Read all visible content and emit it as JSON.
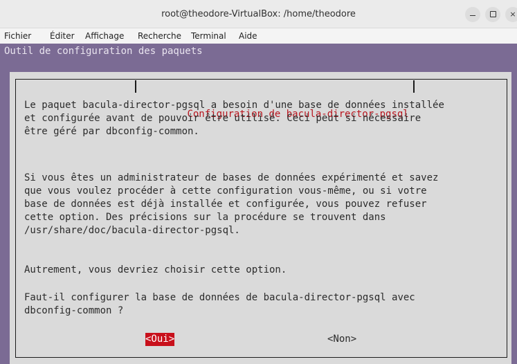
{
  "window": {
    "title": "root@theodore-VirtualBox: /home/theodore",
    "controls": {
      "minimize_icon": "minimize-icon",
      "maximize_icon": "maximize-icon",
      "close_icon": "close-icon",
      "close_glyph": "×"
    }
  },
  "menubar": {
    "items": [
      "Fichier",
      "Éditer",
      "Affichage",
      "Recherche",
      "Terminal",
      "Aide"
    ]
  },
  "terminal": {
    "backtitle": "Outil de configuration des paquets",
    "dialog": {
      "title": "Configuration de bacula-director-pgsql",
      "paragraphs": [
        "Le paquet bacula-director-pgsql a besoin d'une base de données installée\net configurée avant de pouvoir être utilisé. Ceci peut si nécessaire\nêtre géré par dbconfig-common.",
        "Si vous êtes un administrateur de bases de données expérimenté et savez\nque vous voulez procéder à cette configuration vous-même, ou si votre\nbase de données est déjà installée et configurée, vous pouvez refuser\ncette option. Des précisions sur la procédure se trouvent dans\n/usr/share/doc/bacula-director-pgsql.",
        "Autrement, vous devriez choisir cette option.",
        "Faut-il configurer la base de données de bacula-director-pgsql avec\ndbconfig-common ?"
      ],
      "yes_label": "<Oui>",
      "no_label": "<Non>",
      "selected": "yes"
    },
    "colors": {
      "background": "#7b6b94",
      "dialog": "#dadada",
      "accent": "#c8101b"
    }
  }
}
